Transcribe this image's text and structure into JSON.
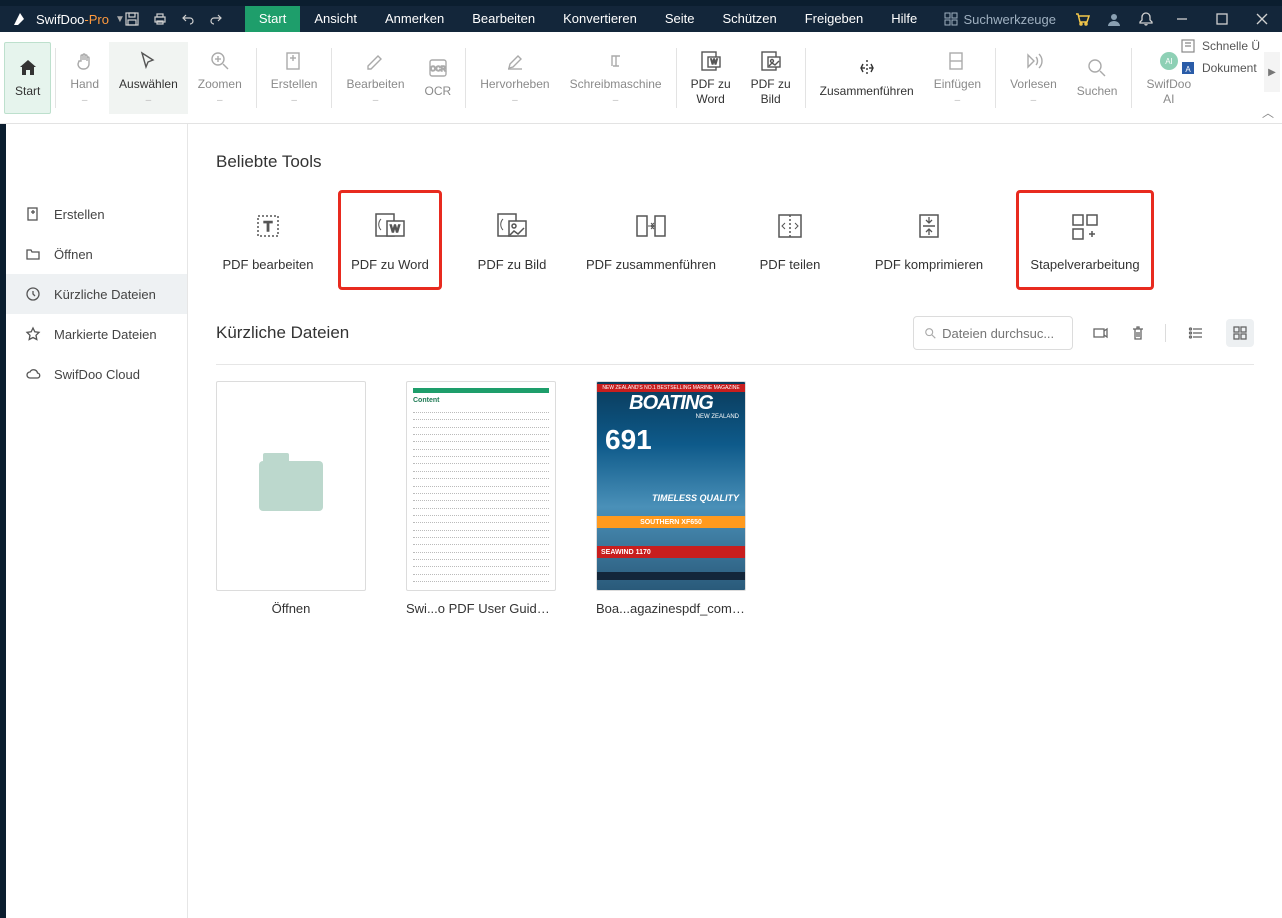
{
  "brand": {
    "name": "SwifDoo",
    "suffix": "-Pro"
  },
  "menus": [
    "Start",
    "Ansicht",
    "Anmerken",
    "Bearbeiten",
    "Konvertieren",
    "Seite",
    "Schützen",
    "Freigeben",
    "Hilfe"
  ],
  "search_tools": "Suchwerkzeuge",
  "ribbon": {
    "start": "Start",
    "hand": "Hand",
    "select": "Auswählen",
    "zoom": "Zoomen",
    "create": "Erstellen",
    "edit": "Bearbeiten",
    "ocr": "OCR",
    "highlight": "Hervorheben",
    "typewriter": "Schreibmaschine",
    "pdf2word": "PDF zu\nWord",
    "pdf2img": "PDF zu\nBild",
    "merge": "Zusammenführen",
    "insert": "Einfügen",
    "read": "Vorlesen",
    "search": "Suchen",
    "ai": "SwifDoo\nAI",
    "quick": "Schnelle Ü",
    "document": "Dokument"
  },
  "sidebar": {
    "create": "Erstellen",
    "open": "Öffnen",
    "recent": "Kürzliche Dateien",
    "marked": "Markierte Dateien",
    "cloud": "SwifDoo Cloud"
  },
  "main": {
    "tools_title": "Beliebte Tools",
    "tools": {
      "edit": "PDF bearbeiten",
      "toword": "PDF zu Word",
      "toimg": "PDF zu Bild",
      "merge": "PDF zusammenführen",
      "split": "PDF teilen",
      "compress": "PDF komprimieren",
      "batch": "Stapelverarbeitung"
    },
    "recent_title": "Kürzliche Dateien",
    "search_placeholder": "Dateien durchsuc...",
    "files": {
      "open": "Öffnen",
      "f1": "Swi...o PDF User Guide_L.pdf",
      "f2": "Boa...agazinespdf_com.pdf"
    },
    "mag": {
      "banner": "NEW ZEALAND'S NO.1 BESTSELLING MARINE MAGAZINE",
      "title": "BOATING",
      "sub": "NEW ZEALAND",
      "num": "691",
      "tq": "TIMELESS QUALITY",
      "xf": "SOUTHERN XF650",
      "sw": "SEAWIND 1170"
    },
    "doc_heading": "Content"
  }
}
